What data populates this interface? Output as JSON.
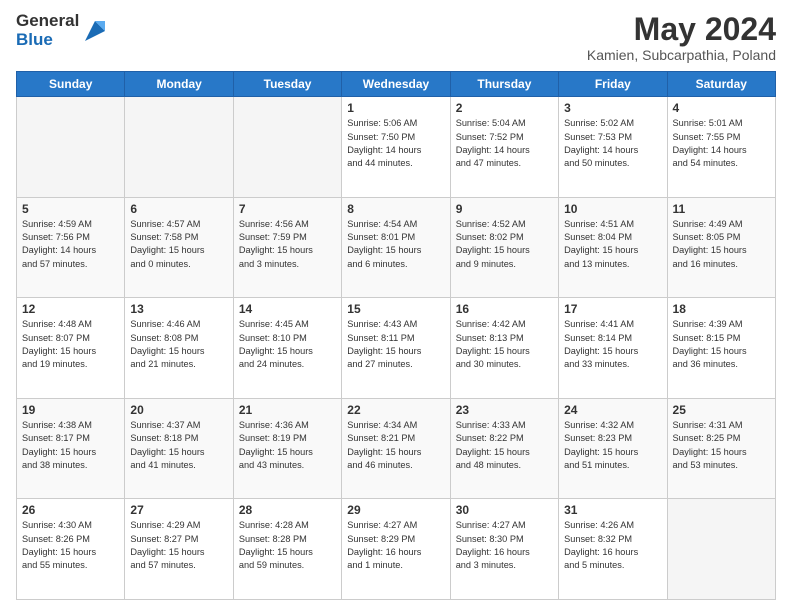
{
  "logo": {
    "general": "General",
    "blue": "Blue"
  },
  "title": "May 2024",
  "location": "Kamien, Subcarpathia, Poland",
  "days_header": [
    "Sunday",
    "Monday",
    "Tuesday",
    "Wednesday",
    "Thursday",
    "Friday",
    "Saturday"
  ],
  "weeks": [
    [
      {
        "day": "",
        "info": ""
      },
      {
        "day": "",
        "info": ""
      },
      {
        "day": "",
        "info": ""
      },
      {
        "day": "1",
        "info": "Sunrise: 5:06 AM\nSunset: 7:50 PM\nDaylight: 14 hours\nand 44 minutes."
      },
      {
        "day": "2",
        "info": "Sunrise: 5:04 AM\nSunset: 7:52 PM\nDaylight: 14 hours\nand 47 minutes."
      },
      {
        "day": "3",
        "info": "Sunrise: 5:02 AM\nSunset: 7:53 PM\nDaylight: 14 hours\nand 50 minutes."
      },
      {
        "day": "4",
        "info": "Sunrise: 5:01 AM\nSunset: 7:55 PM\nDaylight: 14 hours\nand 54 minutes."
      }
    ],
    [
      {
        "day": "5",
        "info": "Sunrise: 4:59 AM\nSunset: 7:56 PM\nDaylight: 14 hours\nand 57 minutes."
      },
      {
        "day": "6",
        "info": "Sunrise: 4:57 AM\nSunset: 7:58 PM\nDaylight: 15 hours\nand 0 minutes."
      },
      {
        "day": "7",
        "info": "Sunrise: 4:56 AM\nSunset: 7:59 PM\nDaylight: 15 hours\nand 3 minutes."
      },
      {
        "day": "8",
        "info": "Sunrise: 4:54 AM\nSunset: 8:01 PM\nDaylight: 15 hours\nand 6 minutes."
      },
      {
        "day": "9",
        "info": "Sunrise: 4:52 AM\nSunset: 8:02 PM\nDaylight: 15 hours\nand 9 minutes."
      },
      {
        "day": "10",
        "info": "Sunrise: 4:51 AM\nSunset: 8:04 PM\nDaylight: 15 hours\nand 13 minutes."
      },
      {
        "day": "11",
        "info": "Sunrise: 4:49 AM\nSunset: 8:05 PM\nDaylight: 15 hours\nand 16 minutes."
      }
    ],
    [
      {
        "day": "12",
        "info": "Sunrise: 4:48 AM\nSunset: 8:07 PM\nDaylight: 15 hours\nand 19 minutes."
      },
      {
        "day": "13",
        "info": "Sunrise: 4:46 AM\nSunset: 8:08 PM\nDaylight: 15 hours\nand 21 minutes."
      },
      {
        "day": "14",
        "info": "Sunrise: 4:45 AM\nSunset: 8:10 PM\nDaylight: 15 hours\nand 24 minutes."
      },
      {
        "day": "15",
        "info": "Sunrise: 4:43 AM\nSunset: 8:11 PM\nDaylight: 15 hours\nand 27 minutes."
      },
      {
        "day": "16",
        "info": "Sunrise: 4:42 AM\nSunset: 8:13 PM\nDaylight: 15 hours\nand 30 minutes."
      },
      {
        "day": "17",
        "info": "Sunrise: 4:41 AM\nSunset: 8:14 PM\nDaylight: 15 hours\nand 33 minutes."
      },
      {
        "day": "18",
        "info": "Sunrise: 4:39 AM\nSunset: 8:15 PM\nDaylight: 15 hours\nand 36 minutes."
      }
    ],
    [
      {
        "day": "19",
        "info": "Sunrise: 4:38 AM\nSunset: 8:17 PM\nDaylight: 15 hours\nand 38 minutes."
      },
      {
        "day": "20",
        "info": "Sunrise: 4:37 AM\nSunset: 8:18 PM\nDaylight: 15 hours\nand 41 minutes."
      },
      {
        "day": "21",
        "info": "Sunrise: 4:36 AM\nSunset: 8:19 PM\nDaylight: 15 hours\nand 43 minutes."
      },
      {
        "day": "22",
        "info": "Sunrise: 4:34 AM\nSunset: 8:21 PM\nDaylight: 15 hours\nand 46 minutes."
      },
      {
        "day": "23",
        "info": "Sunrise: 4:33 AM\nSunset: 8:22 PM\nDaylight: 15 hours\nand 48 minutes."
      },
      {
        "day": "24",
        "info": "Sunrise: 4:32 AM\nSunset: 8:23 PM\nDaylight: 15 hours\nand 51 minutes."
      },
      {
        "day": "25",
        "info": "Sunrise: 4:31 AM\nSunset: 8:25 PM\nDaylight: 15 hours\nand 53 minutes."
      }
    ],
    [
      {
        "day": "26",
        "info": "Sunrise: 4:30 AM\nSunset: 8:26 PM\nDaylight: 15 hours\nand 55 minutes."
      },
      {
        "day": "27",
        "info": "Sunrise: 4:29 AM\nSunset: 8:27 PM\nDaylight: 15 hours\nand 57 minutes."
      },
      {
        "day": "28",
        "info": "Sunrise: 4:28 AM\nSunset: 8:28 PM\nDaylight: 15 hours\nand 59 minutes."
      },
      {
        "day": "29",
        "info": "Sunrise: 4:27 AM\nSunset: 8:29 PM\nDaylight: 16 hours\nand 1 minute."
      },
      {
        "day": "30",
        "info": "Sunrise: 4:27 AM\nSunset: 8:30 PM\nDaylight: 16 hours\nand 3 minutes."
      },
      {
        "day": "31",
        "info": "Sunrise: 4:26 AM\nSunset: 8:32 PM\nDaylight: 16 hours\nand 5 minutes."
      },
      {
        "day": "",
        "info": ""
      }
    ]
  ]
}
